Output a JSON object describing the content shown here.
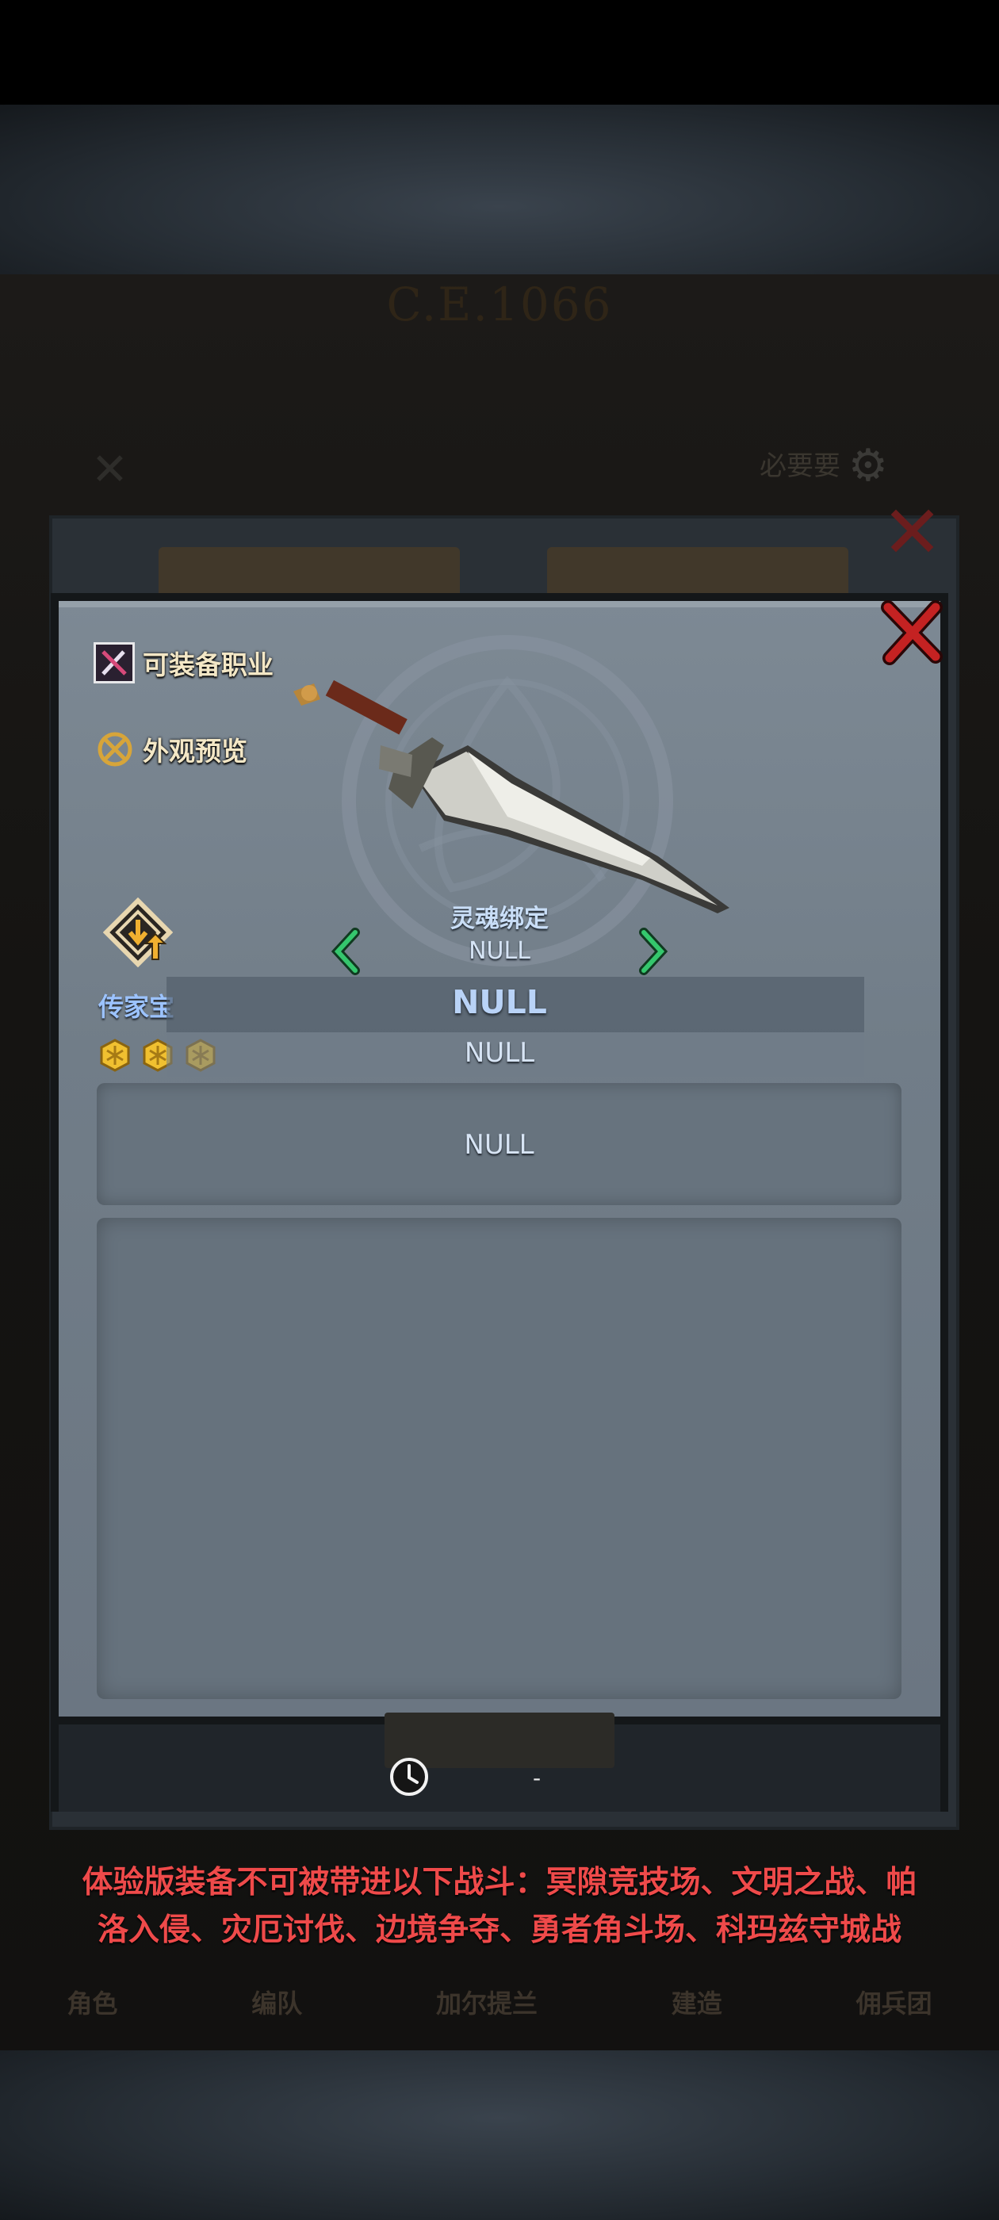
{
  "background": {
    "era_text": "C.E.1066",
    "hint_text": "必要要",
    "bottom_nav": [
      "角色",
      "编队",
      "加尔提兰",
      "建造",
      "佣兵团"
    ]
  },
  "dialog": {
    "equip_class_label": "可装备职业",
    "appearance_preview_label": "外观预览",
    "rarity_label": "传家宝",
    "star_count": 3,
    "soul_bind_label": "灵魂绑定",
    "soul_bind_value": "NULL",
    "item_name": "NULL",
    "item_type": "NULL",
    "description": "NULL",
    "timer_value": "-",
    "icons": {
      "class": "crossed-weapons-icon",
      "appearance": "appearance-preview-icon",
      "rarity": "heirloom-rarity-icon",
      "close": "close-icon",
      "prev": "chevron-left-icon",
      "next": "chevron-right-icon",
      "timer": "clock-icon"
    }
  },
  "notice": {
    "line1": "体验版装备不可被带进以下战斗：冥隙竞技场、文明之战、帕",
    "line2": "洛入侵、灾厄讨伐、边境争夺、勇者角斗场、科玛兹守城战"
  },
  "colors": {
    "notice_text": "#ef4a4a",
    "rarity_text": "#9cc3ff",
    "arrow_green": "#35c76d",
    "close_red": "#c42222",
    "star_gold": "#f0c030"
  }
}
